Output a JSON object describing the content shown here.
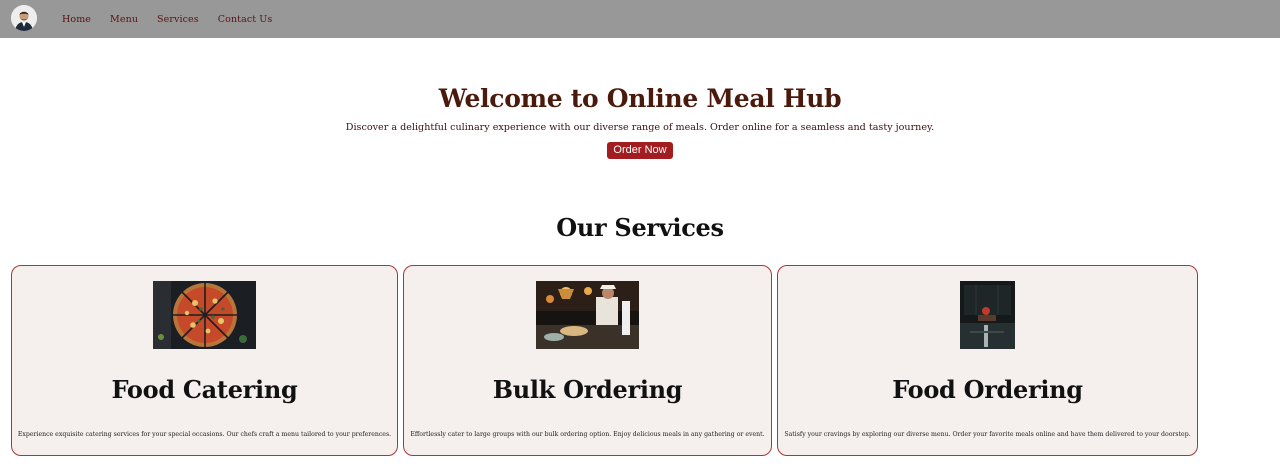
{
  "nav": {
    "links": [
      "Home",
      "Menu",
      "Services",
      "Contact Us"
    ]
  },
  "hero": {
    "title": "Welcome to Online Meal Hub",
    "subtitle": "Discover a delightful culinary experience with our diverse range of meals. Order online for a seamless and tasty journey.",
    "cta_label": "Order Now"
  },
  "services": {
    "title": "Our Services",
    "cards": [
      {
        "title": "Food Catering",
        "description": "Experience exquisite catering services for your special occasions. Our chefs craft a menu tailored to your preferences.",
        "image": "pizza-photo"
      },
      {
        "title": "Bulk Ordering",
        "description": "Effortlessly cater to large groups with our bulk ordering option. Enjoy delicious meals in any gathering or event.",
        "image": "kitchen-chef-photo"
      },
      {
        "title": "Food Ordering",
        "description": "Satisfy your cravings by exploring our diverse menu. Order your favorite meals online and have them delivered to your doorstep.",
        "image": "dark-restaurant-photo"
      }
    ]
  },
  "colors": {
    "navbar_bg": "#989898",
    "nav_link": "#5a1212",
    "hero_title": "#4a1b0c",
    "cta_bg": "#a11d20",
    "card_bg": "#f5f0ee",
    "card_border": "#a33a3a"
  }
}
